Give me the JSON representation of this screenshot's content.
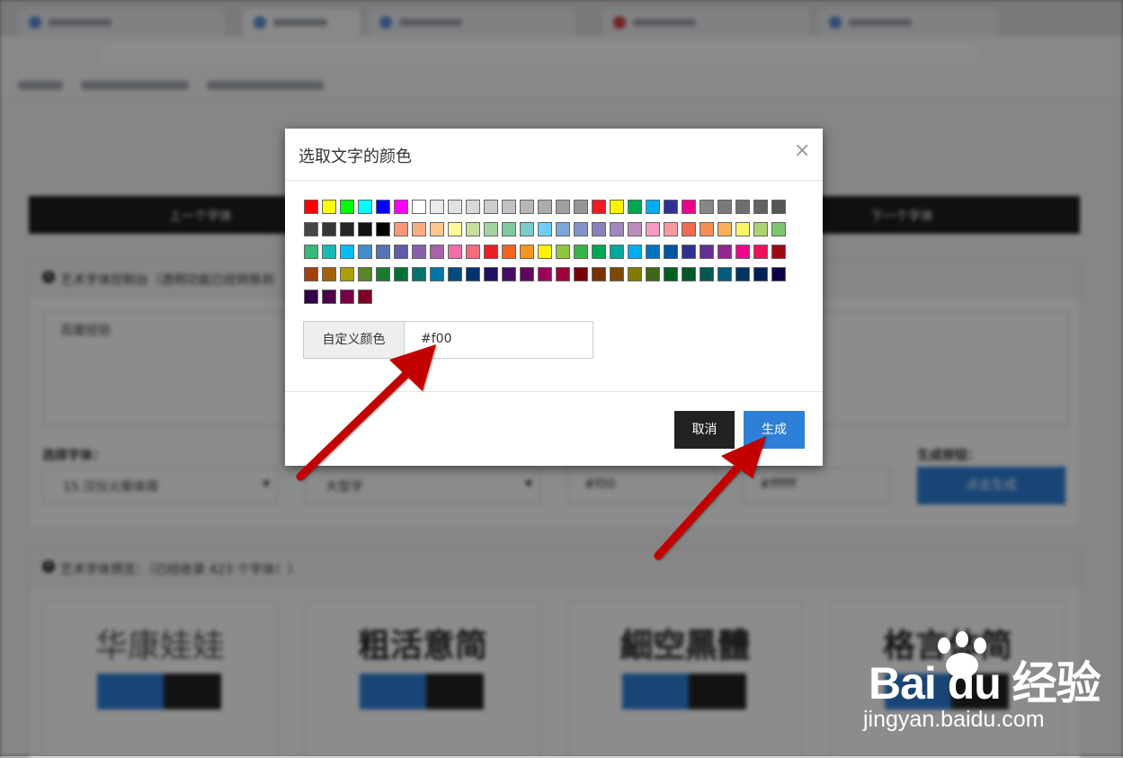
{
  "background": {
    "nav": {
      "prev": "上一个字体",
      "next": "下一个字体"
    },
    "panel": {
      "title": "艺术字体控制台（透明功能已经转移到",
      "textarea_value": "百度经验",
      "font_label": "选择字体：",
      "font_value": "15.汉仪火柴体简",
      "size_value": "大型字",
      "color_value": "#f00",
      "bgcolor_value": "#ffffff",
      "gen_label": "生成按钮：",
      "gen_button": "点击生成"
    },
    "preview": {
      "title": "艺术字体预览：（已经收录 423 个字体！）",
      "cards": [
        "华康娃娃",
        "粗活意简",
        "細空黑體",
        "格言体简"
      ]
    }
  },
  "modal": {
    "title": "选取文字的颜色",
    "close": "×",
    "swatches": [
      "#ff0000",
      "#ffff00",
      "#00ff00",
      "#00ffff",
      "#0000ff",
      "#ff00ff",
      "#ffffff",
      "#ebebeb",
      "#e1e1e1",
      "#d7d7d7",
      "#cccccc",
      "#c2c2c2",
      "#b7b7b7",
      "#acacac",
      "#a0a0a0",
      "#959595",
      "#ee1d24",
      "#fff100",
      "#00a650",
      "#00aeef",
      "#2f3192",
      "#ed008c",
      "#868686",
      "#7a7a7a",
      "#6e6e6e",
      "#626262",
      "#555555",
      "#464646",
      "#363636",
      "#262626",
      "#111111",
      "#000000",
      "#f7977a",
      "#fbad82",
      "#fdc68c",
      "#fff799",
      "#c6df9c",
      "#a4d49d",
      "#81ca9d",
      "#7bcdc9",
      "#6ccff7",
      "#7ca6d8",
      "#8293ca",
      "#8881be",
      "#a286bd",
      "#bc8cbf",
      "#f49bc1",
      "#f5999d",
      "#f16c4d",
      "#f68e54",
      "#fbaf5a",
      "#fff467",
      "#acd372",
      "#7dc473",
      "#39b778",
      "#16bcb4",
      "#00bff3",
      "#438ccb",
      "#5573b7",
      "#5e5ca7",
      "#855fa8",
      "#a763a9",
      "#ef6ea8",
      "#f16d7e",
      "#ee1d24",
      "#f16522",
      "#f7941d",
      "#fff100",
      "#8fc63d",
      "#37b44a",
      "#00a650",
      "#00a99e",
      "#00aeef",
      "#0072bc",
      "#0054a5",
      "#2f3192",
      "#652c91",
      "#91278f",
      "#ed008c",
      "#ee105a",
      "#9d0a0f",
      "#a1410d",
      "#a36209",
      "#aba000",
      "#588528",
      "#197b30",
      "#007236",
      "#00736a",
      "#0076a4",
      "#004a80",
      "#003370",
      "#1d1363",
      "#450e61",
      "#62055f",
      "#9e005c",
      "#9d0039",
      "#790000",
      "#7b3000",
      "#7c4900",
      "#827a00",
      "#3e6617",
      "#045f20",
      "#005824",
      "#005951",
      "#005b7e",
      "#003562",
      "#002056",
      "#0c004b",
      "#30004a",
      "#4b0048",
      "#7a0045",
      "#7a0026"
    ],
    "custom_label": "自定义颜色",
    "custom_value": "#f00",
    "cancel": "取消",
    "generate": "生成"
  },
  "watermark": {
    "brand": "Bai du 经验",
    "url": "jingyan.baidu.com"
  }
}
